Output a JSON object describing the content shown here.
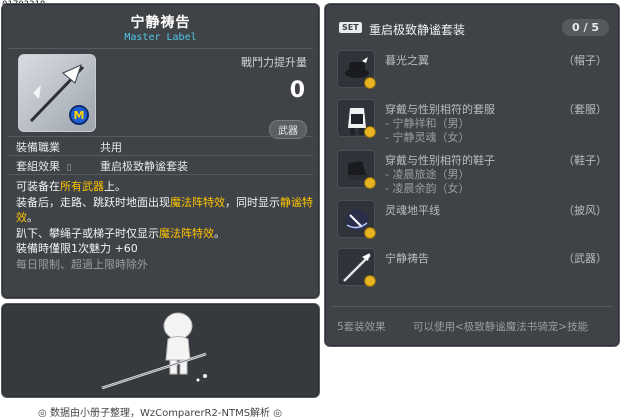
{
  "item_id": "01703318",
  "item": {
    "name": "宁静祷告",
    "grade_label": "Master Label",
    "power_label": "戰鬥力提升量",
    "power_value": "0",
    "category": "武器",
    "job_label": "裝備職業",
    "job_value": "共用",
    "set_label": "套組效果",
    "set_value": "重启极致静谧套装",
    "desc": [
      {
        "text": "可装备在"
      },
      {
        "text": "所有武器",
        "hl": true
      },
      {
        "text": "上。",
        "br": true
      },
      {
        "text": "装备后，走路、跳跃时地面出现"
      },
      {
        "text": "魔法阵特效",
        "hl": true
      },
      {
        "text": "，同时显示"
      },
      {
        "text": "静谧特效",
        "hl": true
      },
      {
        "text": "。",
        "br": true
      },
      {
        "text": "趴下、攀绳子或梯子时仅显示"
      },
      {
        "text": "魔法阵特效",
        "hl": true
      },
      {
        "text": "。",
        "br": true
      },
      {
        "text": "裝備時僅限1次魅力 +60",
        "br": true
      },
      {
        "text": "每日限制、超過上限時除外",
        "muted": true
      }
    ]
  },
  "set": {
    "tag": "SET",
    "name": "重启极致静谧套装",
    "count": "0 / 5",
    "items": [
      {
        "name": "暮光之翼",
        "type": "（帽子）",
        "sub": []
      },
      {
        "name": "穿戴与性别相符的套服",
        "type": "（套服）",
        "sub": [
          "- 宁静祥和（男）",
          "- 宁静灵魂（女）"
        ]
      },
      {
        "name": "穿戴与性别相符的鞋子",
        "type": "（鞋子）",
        "sub": [
          "- 凌晨旅途（男）",
          "- 凌晨余韵（女）"
        ]
      },
      {
        "name": "灵魂地平线",
        "type": "（披风）",
        "sub": []
      },
      {
        "name": "宁静祷告",
        "type": "（武器）",
        "sub": []
      }
    ],
    "effect_label": "5套装效果",
    "effect_desc": "可以使用<极致静谧魔法书骑宠>技能"
  },
  "footer": "◎ 数据由小册子整理，WzComparerR2-NTMS解析 ◎"
}
